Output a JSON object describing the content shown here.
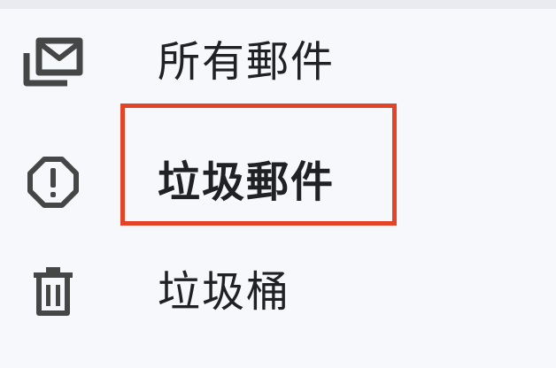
{
  "menu": {
    "items": [
      {
        "label": "所有郵件",
        "icon": "all-mail-icon",
        "selected": false
      },
      {
        "label": "垃圾郵件",
        "icon": "spam-icon",
        "selected": true
      },
      {
        "label": "垃圾桶",
        "icon": "trash-icon",
        "selected": false
      }
    ]
  },
  "colors": {
    "background": "#f6f8fc",
    "top_strip": "#e9ebf0",
    "icon": "#444746",
    "text": "#202124",
    "highlight_border": "#e34327"
  }
}
